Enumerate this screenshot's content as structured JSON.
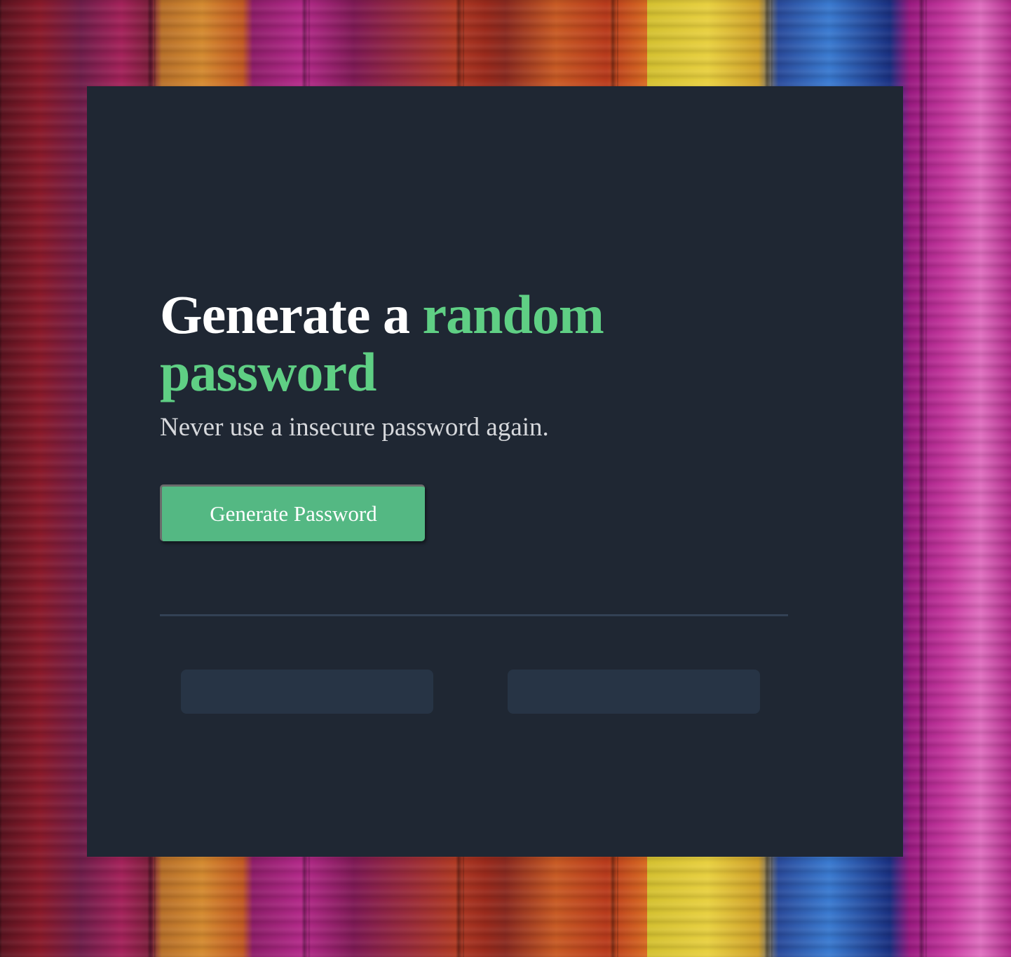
{
  "header": {
    "title_part1": "Generate a ",
    "title_accent": "random password",
    "subtitle": "Never use a insecure password again."
  },
  "actions": {
    "generate_label": "Generate Password"
  },
  "outputs": [
    {
      "value": ""
    },
    {
      "value": ""
    }
  ],
  "colors": {
    "card_background": "#1f2733",
    "accent": "#5fcf84",
    "button": "#54b883",
    "output_background": "#273445",
    "divider": "#334155"
  }
}
